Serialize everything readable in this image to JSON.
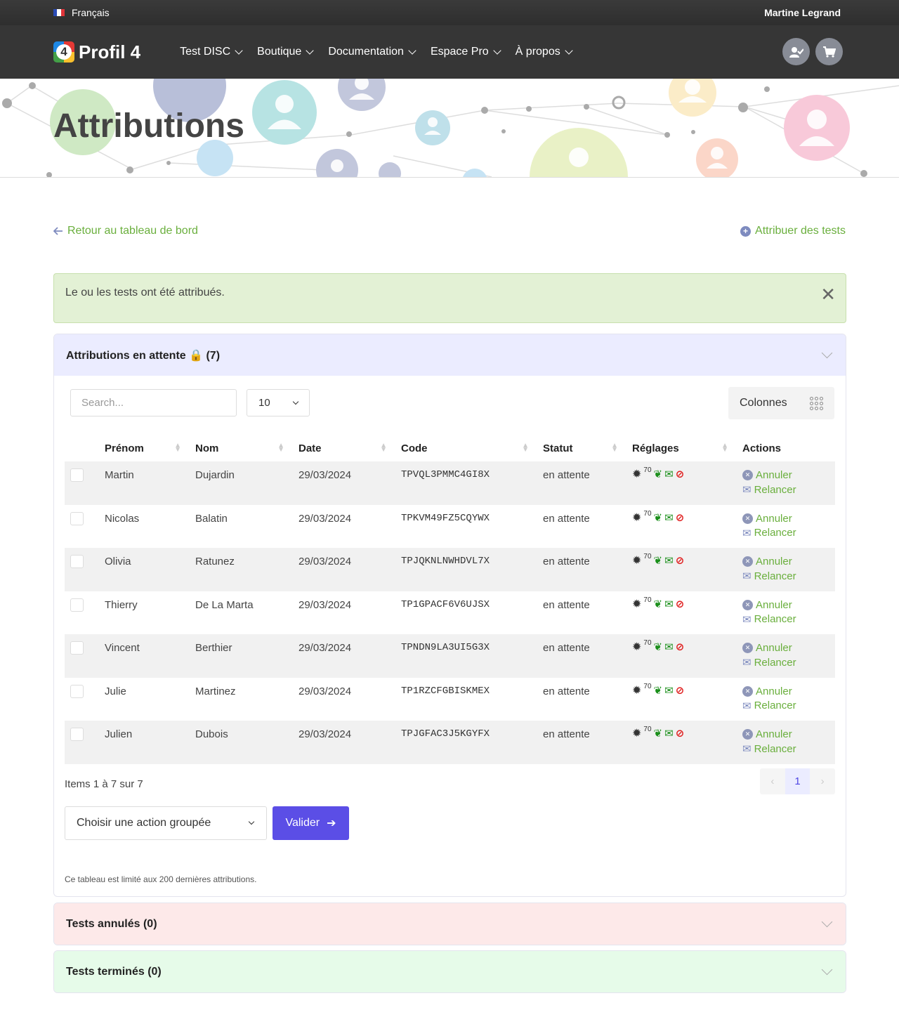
{
  "topbar": {
    "language": "Français",
    "user": "Martine Legrand"
  },
  "brand": {
    "name": "Profil 4",
    "mark": "4"
  },
  "nav": [
    "Test DISC",
    "Boutique",
    "Documentation",
    "Espace Pro",
    "À propos"
  ],
  "icons": {
    "user_check": "user-check-icon",
    "cart": "cart-icon"
  },
  "page_title": "Attributions",
  "back_link": "Retour au tableau de bord",
  "assign_link": "Attribuer des tests",
  "alert": {
    "message": "Le ou les tests ont été attribués.",
    "close": "✕"
  },
  "pending": {
    "title": "Attributions en attente 🔒 (7)",
    "search_placeholder": "Search...",
    "per_page": "10",
    "columns_button": "Colonnes",
    "headers": [
      "Prénom",
      "Nom",
      "Date",
      "Code",
      "Statut",
      "Réglages",
      "Actions"
    ],
    "rows": [
      {
        "first": "Martin",
        "last": "Dujardin",
        "date": "29/03/2024",
        "code": "TPVQL3PMMC4GI8X",
        "status": "en attente"
      },
      {
        "first": "Nicolas",
        "last": "Balatin",
        "date": "29/03/2024",
        "code": "TPKVM49FZ5CQYWX",
        "status": "en attente"
      },
      {
        "first": "Olivia",
        "last": "Ratunez",
        "date": "29/03/2024",
        "code": "TPJQKNLNWHDVL7X",
        "status": "en attente"
      },
      {
        "first": "Thierry",
        "last": "De La Marta",
        "date": "29/03/2024",
        "code": "TP1GPACF6V6UJSX",
        "status": "en attente"
      },
      {
        "first": "Vincent",
        "last": "Berthier",
        "date": "29/03/2024",
        "code": "TPNDN9LA3UI5G3X",
        "status": "en attente"
      },
      {
        "first": "Julie",
        "last": "Martinez",
        "date": "29/03/2024",
        "code": "TP1RZCFGBISKMEX",
        "status": "en attente"
      },
      {
        "first": "Julien",
        "last": "Dubois",
        "date": "29/03/2024",
        "code": "TPJGFAC3J5KGYFX",
        "status": "en attente"
      }
    ],
    "settings_value": "70",
    "action_cancel": "Annuler",
    "action_remind": "Relancer",
    "items_info": "Items 1 à 7 sur 7",
    "page_current": "1",
    "bulk_placeholder": "Choisir une action groupée",
    "validate": "Valider",
    "note": "Ce tableau est limité aux 200 dernières attributions."
  },
  "cancelled": {
    "title": "Tests annulés (0)"
  },
  "finished": {
    "title": "Tests terminés (0)"
  },
  "colors": {
    "accent": "#5b4ee6",
    "link_green": "#6aaf3d",
    "topbar": "#363636"
  }
}
